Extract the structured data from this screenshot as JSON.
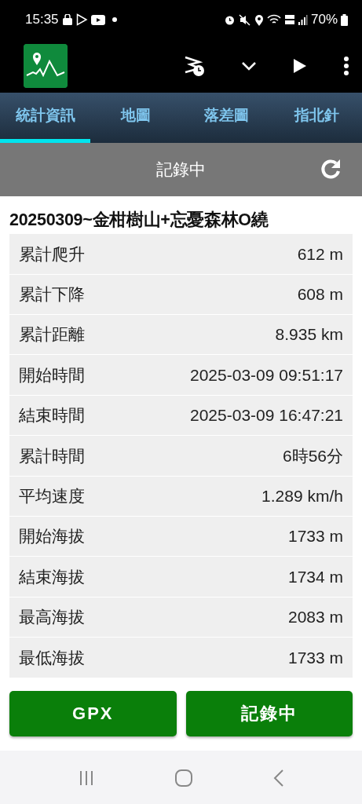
{
  "status_bar": {
    "time": "15:35",
    "battery": "70%"
  },
  "tabs": [
    {
      "label": "統計資訊",
      "selected": true
    },
    {
      "label": "地圖",
      "selected": false
    },
    {
      "label": "落差圖",
      "selected": false
    },
    {
      "label": "指北針",
      "selected": false
    }
  ],
  "header": {
    "title": "記錄中"
  },
  "track_title": "20250309~金柑樹山+忘憂森林O繞",
  "stats": [
    {
      "label": "累計爬升",
      "value": "612 m"
    },
    {
      "label": "累計下降",
      "value": "608 m"
    },
    {
      "label": "累計距離",
      "value": "8.935 km"
    },
    {
      "label": "開始時間",
      "value": "2025-03-09 09:51:17"
    },
    {
      "label": "結束時間",
      "value": "2025-03-09 16:47:21"
    },
    {
      "label": "累計時間",
      "value": "6時56分"
    },
    {
      "label": "平均速度",
      "value": "1.289 km/h"
    },
    {
      "label": "開始海拔",
      "value": "1733 m"
    },
    {
      "label": "結束海拔",
      "value": "1734 m"
    },
    {
      "label": "最高海拔",
      "value": "2083 m"
    },
    {
      "label": "最低海拔",
      "value": "1733 m"
    }
  ],
  "buttons": [
    "GPX",
    "記錄中"
  ]
}
